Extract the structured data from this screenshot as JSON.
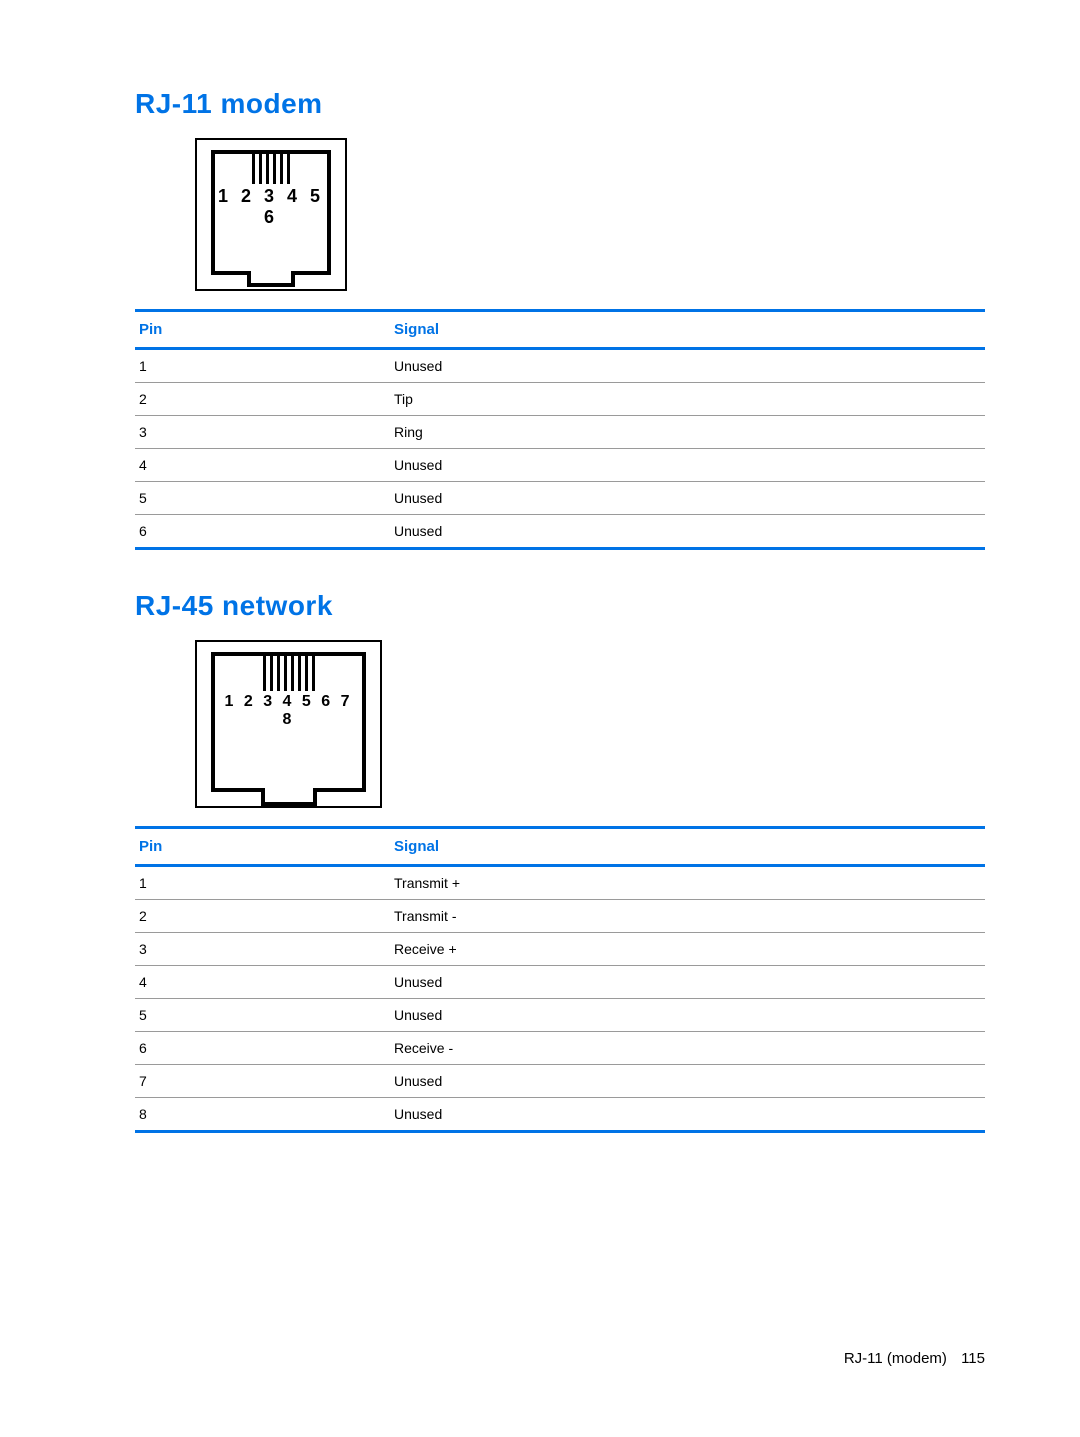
{
  "sections": [
    {
      "heading": "RJ-11 modem",
      "connector": {
        "pin_count": 6,
        "numbers": "1 2 3 4 5 6"
      },
      "table": {
        "headers": [
          "Pin",
          "Signal"
        ],
        "rows": [
          [
            "1",
            "Unused"
          ],
          [
            "2",
            "Tip"
          ],
          [
            "3",
            "Ring"
          ],
          [
            "4",
            "Unused"
          ],
          [
            "5",
            "Unused"
          ],
          [
            "6",
            "Unused"
          ]
        ]
      }
    },
    {
      "heading": "RJ-45 network",
      "connector": {
        "pin_count": 8,
        "numbers": "1 2 3 4 5 6 7 8"
      },
      "table": {
        "headers": [
          "Pin",
          "Signal"
        ],
        "rows": [
          [
            "1",
            "Transmit +"
          ],
          [
            "2",
            "Transmit -"
          ],
          [
            "3",
            "Receive +"
          ],
          [
            "4",
            "Unused"
          ],
          [
            "5",
            "Unused"
          ],
          [
            "6",
            "Receive -"
          ],
          [
            "7",
            "Unused"
          ],
          [
            "8",
            "Unused"
          ]
        ]
      }
    }
  ],
  "footer": {
    "text": "RJ-11 (modem)",
    "page": "115"
  }
}
